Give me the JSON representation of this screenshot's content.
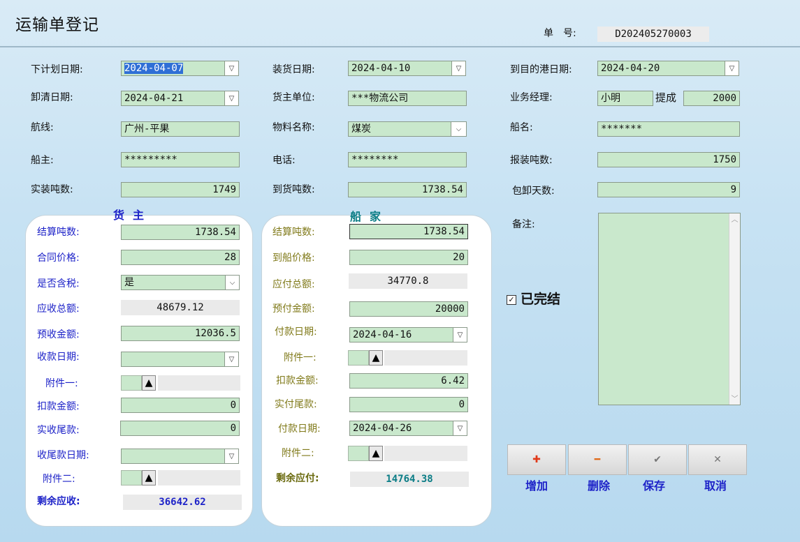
{
  "window": {
    "title": "运输单登记"
  },
  "order": {
    "label": "单　号:",
    "value": "D202405270003"
  },
  "row1": {
    "plan_date_label": "下计划日期:",
    "plan_date": "2024-04-07",
    "load_date_label": "装货日期:",
    "load_date": "2024-04-10",
    "arrive_date_label": "到目的港日期:",
    "arrive_date": "2024-04-20"
  },
  "row2": {
    "unload_date_label": "卸清日期:",
    "unload_date": "2024-04-21",
    "shipper_label": "货主单位:",
    "shipper": "***物流公司",
    "manager_label": "业务经理:",
    "manager": "小明",
    "commission_label": "提成",
    "commission": "2000"
  },
  "row3": {
    "route_label": "航线:",
    "route": "广州-平果",
    "material_label": "物料名称:",
    "material": "煤炭",
    "ship_label": "船名:",
    "ship": "*******"
  },
  "row4": {
    "owner_label": "船主:",
    "owner": "*********",
    "phone_label": "电话:",
    "phone": "********",
    "declared_label": "报装吨数:",
    "declared": "1750"
  },
  "row5": {
    "actual_label": "实装吨数:",
    "actual": "1749",
    "arrived_label": "到货吨数:",
    "arrived": "1738.54",
    "days_label": "包卸天数:",
    "days": "9"
  },
  "cargo": {
    "header": "货主",
    "settle_label": "结算吨数:",
    "settle": "1738.54",
    "price_label": "合同价格:",
    "price": "28",
    "tax_label": "是否含税:",
    "tax": "是",
    "receivable_label": "应收总额:",
    "receivable": "48679.12",
    "prepaid_label": "预收金额:",
    "prepaid": "12036.5",
    "receipt_date_label": "收款日期:",
    "receipt_date": "",
    "attach1_label": "附件一:",
    "deduct_label": "扣款金额:",
    "deduct": "0",
    "balance_label": "实收尾款:",
    "balance": "0",
    "balance_date_label": "收尾款日期:",
    "balance_date": "",
    "attach2_label": "附件二:",
    "remain_label": "剩余应收:",
    "remain": "36642.62"
  },
  "shipowner": {
    "header": "船家",
    "settle_label": "结算吨数:",
    "settle": "1738.54",
    "price_label": "到船价格:",
    "price": "20",
    "payable_label": "应付总额:",
    "payable": "34770.8",
    "prepaid_label": "预付金额:",
    "prepaid": "20000",
    "pay_date_label": "付款日期:",
    "pay_date": "2024-04-16",
    "attach1_label": "附件一:",
    "deduct_label": "扣款金额:",
    "deduct": "6.42",
    "balance_label": "实付尾款:",
    "balance": "0",
    "pay_date2_label": "付款日期:",
    "pay_date2": "2024-04-26",
    "attach2_label": "附件二:",
    "remain_label": "剩余应付:",
    "remain": "14764.38"
  },
  "memo": {
    "label": "备注:",
    "value": ""
  },
  "completed": {
    "label": "已完结",
    "checked": true
  },
  "buttons": {
    "add": "增加",
    "delete": "删除",
    "save": "保存",
    "cancel": "取消"
  },
  "colors": {
    "field": "#c9e8cc",
    "label_blue": "#1d22c8",
    "label_olive": "#807a1a",
    "teal": "#0b7d86"
  }
}
